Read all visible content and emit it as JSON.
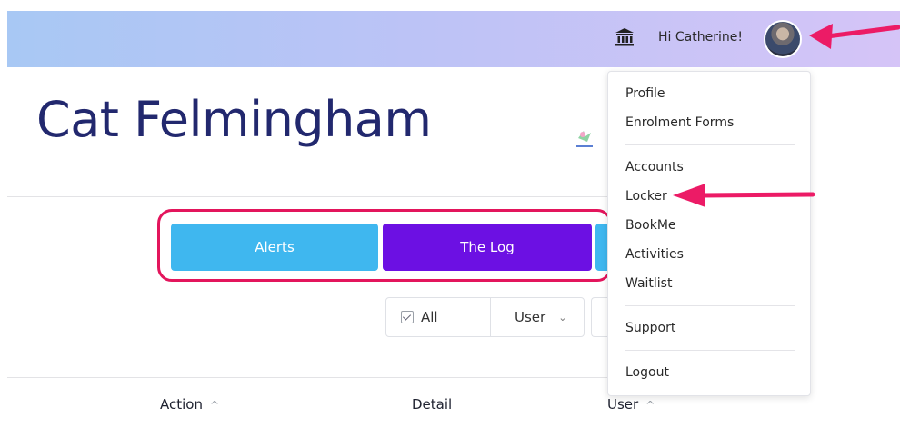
{
  "header": {
    "greeting": "Hi Catherine!",
    "bank_icon": "bank-icon",
    "avatar_icon": "user-avatar"
  },
  "page": {
    "title": "Cat Felmingham"
  },
  "tabs": [
    {
      "label": "Alerts"
    },
    {
      "label": "The Log"
    }
  ],
  "filters": {
    "all_label": "All",
    "user_label": "User"
  },
  "table": {
    "columns": [
      "Action",
      "Detail",
      "User"
    ]
  },
  "user_menu": {
    "items": [
      "Profile",
      "Enrolment Forms",
      "Accounts",
      "Locker",
      "BookMe",
      "Activities",
      "Waitlist",
      "Support",
      "Logout"
    ]
  },
  "colors": {
    "accent_blue": "#3fb7ef",
    "accent_purple": "#6c10e3",
    "highlight_pink": "#e3155c",
    "title_navy": "#22286e"
  }
}
